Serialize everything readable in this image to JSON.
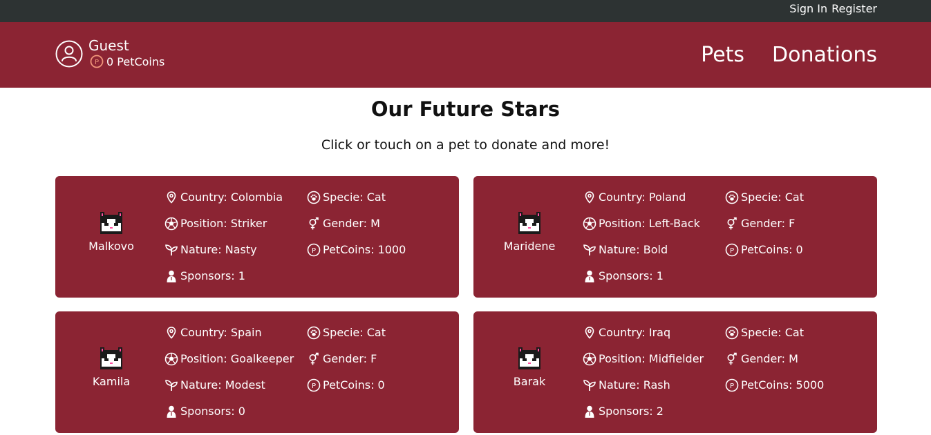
{
  "topbar": {
    "sign_in": "Sign In",
    "register": "Register"
  },
  "header": {
    "user_name": "Guest",
    "coins": "0 PetCoins",
    "nav": {
      "pets": "Pets",
      "donations": "Donations"
    }
  },
  "page": {
    "title": "Our Future Stars",
    "subtitle": "Click or touch on a pet to donate and more!"
  },
  "pets": [
    {
      "name": "Malkovo",
      "country": "Country: Colombia",
      "position": "Position: Striker",
      "nature": "Nature: Nasty",
      "sponsors": "Sponsors: 1",
      "specie": "Specie: Cat",
      "gender": "Gender: M",
      "petcoins": "PetCoins: 1000",
      "gender_icon": "female-male-icon"
    },
    {
      "name": "Maridene",
      "country": "Country: Poland",
      "position": "Position: Left-Back",
      "nature": "Nature: Bold",
      "sponsors": "Sponsors: 1",
      "specie": "Specie: Cat",
      "gender": "Gender: F",
      "petcoins": "PetCoins: 0",
      "gender_icon": "female-male-icon"
    },
    {
      "name": "Kamila",
      "country": "Country: Spain",
      "position": "Position: Goalkeeper",
      "nature": "Nature: Modest",
      "sponsors": "Sponsors: 0",
      "specie": "Specie: Cat",
      "gender": "Gender: F",
      "petcoins": "PetCoins: 0",
      "gender_icon": "female-male-icon"
    },
    {
      "name": "Barak",
      "country": "Country: Iraq",
      "position": "Position: Midfielder",
      "nature": "Nature: Rash",
      "sponsors": "Sponsors: 2",
      "specie": "Specie: Cat",
      "gender": "Gender: M",
      "petcoins": "PetCoins: 5000",
      "gender_icon": "female-male-icon"
    }
  ],
  "colors": {
    "topbar": "#2d3333",
    "brand": "#8b2433",
    "coin": "#f0967a",
    "text_light": "#ffffff"
  },
  "icons": [
    "user-circle-icon",
    "petcoin-icon",
    "location-pin-icon",
    "soccer-ball-icon",
    "sprout-icon",
    "person-icon",
    "paw-icon",
    "gender-icon",
    "cat-sprite-icon"
  ]
}
